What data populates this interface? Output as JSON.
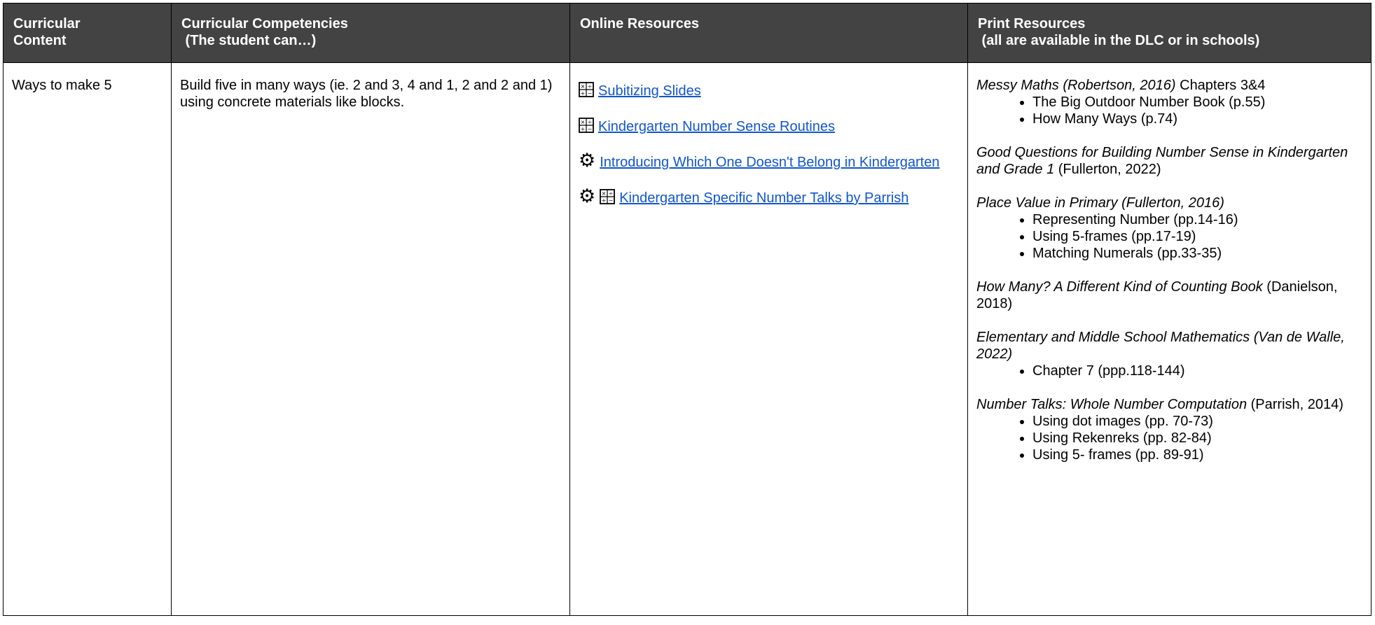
{
  "headers": [
    {
      "line1": "Curricular",
      "line2": "Content"
    },
    {
      "line1": "Curricular Competencies",
      "line2": " (The student can…)"
    },
    {
      "line1": "Online Resources",
      "line2": ""
    },
    {
      "line1": "Print Resources",
      "line2": " (all are available in the DLC or in schools)"
    }
  ],
  "row": {
    "content": "Ways to make 5",
    "competency": "Build five in many ways (ie. 2 and 3, 4 and 1, 2 and 2 and 1) using concrete materials like blocks.",
    "online": [
      {
        "icons": [
          "math-symbols-icon"
        ],
        "label": "Subitizing Slides"
      },
      {
        "icons": [
          "math-symbols-icon"
        ],
        "label": "Kindergarten Number Sense Routines"
      },
      {
        "icons": [
          "gear-icon"
        ],
        "label": "Introducing Which One Doesn't Belong in Kindergarten"
      },
      {
        "icons": [
          "gear-icon",
          "math-symbols-icon"
        ],
        "label": "Kindergarten Specific Number Talks by Parrish"
      }
    ],
    "print": [
      {
        "title": "Messy Maths (Robertson, 2016)",
        "rest": " Chapters 3&4",
        "items": [
          "The Big Outdoor Number Book (p.55)",
          "How Many Ways (p.74)"
        ]
      },
      {
        "title": "Good Questions for Building Number Sense in Kindergarten and Grade 1",
        "rest": " (Fullerton, 2022)",
        "items": []
      },
      {
        "title": "Place Value in Primary (Fullerton, 2016)",
        "rest": "",
        "items": [
          "Representing Number (pp.14-16)",
          "Using 5-frames (pp.17-19)",
          "Matching Numerals (pp.33-35)"
        ]
      },
      {
        "title": "How Many? A Different Kind of Counting Book",
        "rest": " (Danielson, 2018)",
        "items": []
      },
      {
        "title": "Elementary and Middle School Mathematics (Van de Walle, 2022)",
        "rest": "",
        "items": [
          "Chapter 7 (ppp.118-144)"
        ]
      },
      {
        "title": "Number Talks: Whole Number Computation",
        "rest": " (Parrish, 2014)",
        "items": [
          "Using dot images (pp. 70-73)",
          "Using Rekenreks (pp. 82-84)",
          "Using 5- frames (pp. 89-91)"
        ]
      }
    ]
  }
}
